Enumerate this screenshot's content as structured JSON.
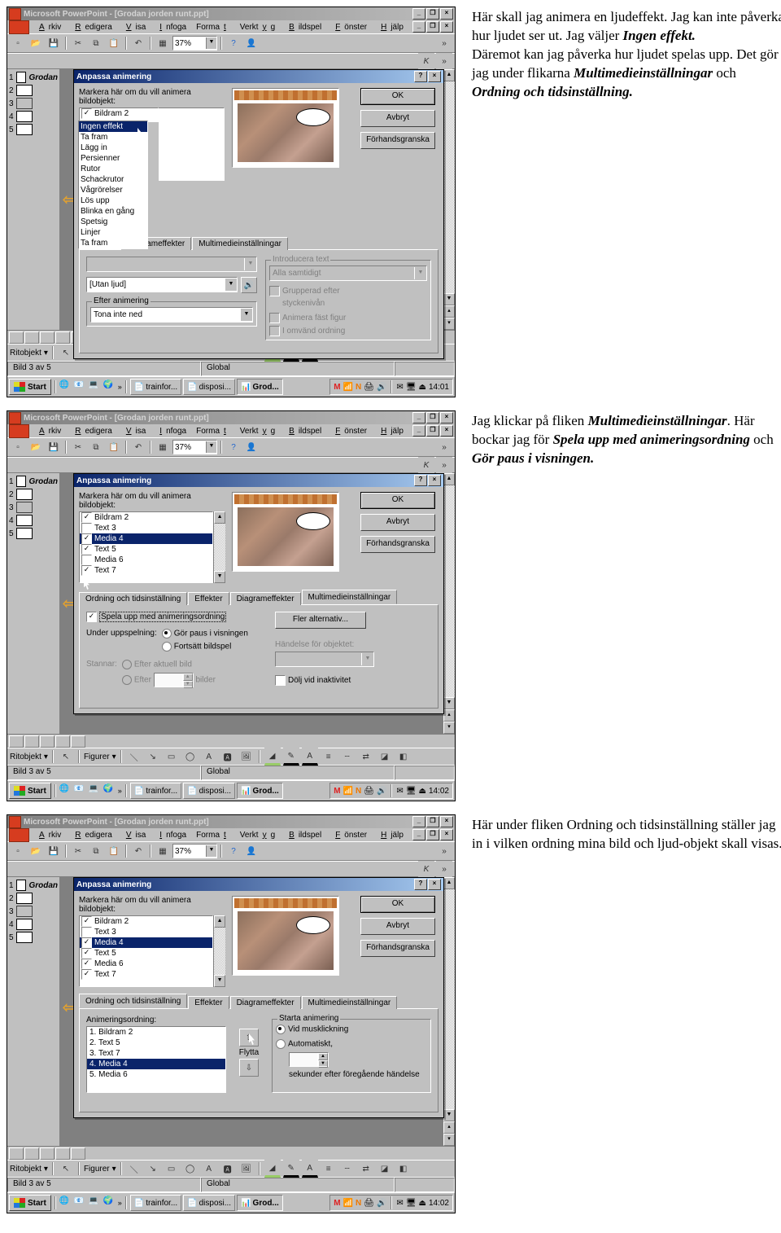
{
  "app": {
    "title": "Microsoft PowerPoint - [Grodan jorden runt.ppt]",
    "menu": [
      "Arkiv",
      "Redigera",
      "Visa",
      "Infoga",
      "Format",
      "Verktyg",
      "Bildspel",
      "Fönster",
      "Hjälp"
    ],
    "zoom": "37%",
    "slide_title": "Grodan",
    "slides": [
      "1",
      "2",
      "3",
      "4",
      "5"
    ],
    "status_slide": "Bild 3 av 5",
    "status_right": "Global",
    "lowbar_draw": "Ritobjekt",
    "lowbar_fig": "Figurer"
  },
  "dlg": {
    "title": "Anpassa animering",
    "markera": "Markera här om du vill animera bildobjekt:",
    "ok": "OK",
    "avbryt": "Avbryt",
    "forhand": "Förhandsgranska",
    "tabs": {
      "ordning": "Ordning och tidsinställning",
      "effekter": "Effekter",
      "diagram": "Diagrameffekter",
      "multi": "Multimedieinställningar"
    }
  },
  "s1": {
    "list_top": "Bildram 2",
    "effects": [
      "Ingen effekt",
      "Ta fram",
      "Lägg in",
      "Persienner",
      "Rutor",
      "Schackrutor",
      "Vågrörelser",
      "Lös upp",
      "Blinka en gång",
      "Spetsig",
      "Linjer",
      "Ta fram"
    ],
    "introducera": "Introducera text",
    "alla": "Alla samtidigt",
    "grupperad": "Grupperad efter",
    "stycken": "styckenivån",
    "animnast": "Animera fäst figur",
    "omvand": "I omvänd ordning",
    "utan_ljud": "[Utan ljud]",
    "efter": "Efter animering",
    "tona": "Tona inte ned"
  },
  "s2": {
    "items": [
      {
        "label": "Bildram 2",
        "checked": true
      },
      {
        "label": "Text 3",
        "checked": false
      },
      {
        "label": "Media 4",
        "checked": true,
        "sel": true
      },
      {
        "label": "Text 5",
        "checked": true
      },
      {
        "label": "Media 6",
        "checked": false
      },
      {
        "label": "Text 7",
        "checked": true
      }
    ],
    "spela": "Spela upp med animeringsordning",
    "under": "Under uppspelning:",
    "gor_paus": "Gör paus i visningen",
    "fortsatt": "Fortsätt bildspel",
    "stannar": "Stannar:",
    "efter_aktuell": "Efter aktuell bild",
    "efter": "Efter",
    "bilder": "bilder",
    "fler": "Fler alternativ...",
    "handelse": "Händelse för objektet:",
    "dolj": "Dölj vid inaktivitet"
  },
  "s3": {
    "items": [
      {
        "label": "Bildram 2",
        "checked": true
      },
      {
        "label": "Text 3",
        "checked": false
      },
      {
        "label": "Media 4",
        "checked": true,
        "sel": true
      },
      {
        "label": "Text 5",
        "checked": true
      },
      {
        "label": "Media 6",
        "checked": true
      },
      {
        "label": "Text 7",
        "checked": true
      }
    ],
    "animord": "Animeringsordning:",
    "order": [
      "1. Bildram 2",
      "2. Text 5",
      "3. Text 7",
      "4. Media 4",
      "5. Media 6"
    ],
    "flytta": "Flytta",
    "starta": "Starta animering",
    "vid": "Vid musklickning",
    "auto": "Automatiskt,",
    "sek": "sekunder efter föregående händelse"
  },
  "taskbar": {
    "start": "Start",
    "tasks": [
      "trainfor...",
      "disposi...",
      "Grod..."
    ],
    "time1": "14:01",
    "time2": "14:02",
    "time3": "14:02"
  },
  "desc1_a": "Här skall jag animera en ljudeffekt. Jag kan inte påverka hur ljudet ser ut. Jag väljer ",
  "desc1_b": "Ingen effekt.",
  "desc1_c": "Däremot kan jag påverka hur ljudet spelas upp. Det gör jag under flikarna ",
  "desc1_d": "Multimedieinställningar",
  "desc1_e": " och ",
  "desc1_f": "Ordning och tidsinställning.",
  "desc2_a": "Jag klickar på fliken ",
  "desc2_b": "Multimedieinställningar",
  "desc2_c": ". Här bockar jag för ",
  "desc2_d": "Spela upp med animeringsordning",
  "desc2_e": " och ",
  "desc2_f": "Gör paus i visningen.",
  "desc3": "Här under fliken Ordning och tidsinställning ställer jag in i vilken ordning mina bild och ljud-objekt skall visas."
}
